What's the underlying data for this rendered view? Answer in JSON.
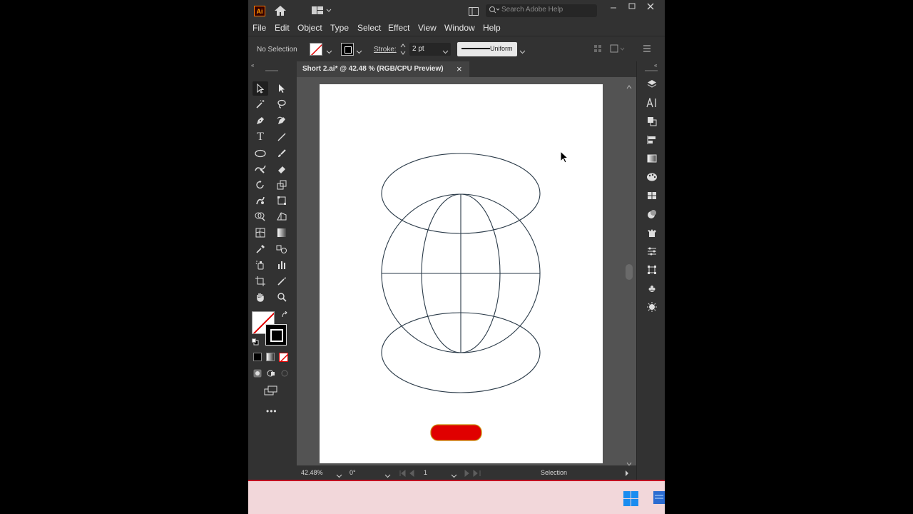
{
  "app": {
    "logo": "Ai",
    "search_placeholder": "Search Adobe Help"
  },
  "menu": [
    "File",
    "Edit",
    "Object",
    "Type",
    "Select",
    "Effect",
    "View",
    "Window",
    "Help"
  ],
  "control": {
    "selection_label": "No Selection",
    "stroke_label": "Stroke:",
    "stroke_value": "2 pt",
    "profile_label": "Uniform"
  },
  "document": {
    "tab_title": "Short 2.ai* @ 42.48 % (RGB/CPU Preview)",
    "close": "×"
  },
  "status": {
    "zoom": "42.48%",
    "rotation": "0°",
    "artboard": "1",
    "tool": "Selection"
  },
  "colors": {
    "panel": "#323232",
    "canvas": "#535353",
    "accent_red": "#e00000",
    "taskbar": "#f2d7da"
  },
  "icons": [
    "home-icon",
    "workspace-icon",
    "search-icon",
    "minimize-icon",
    "maximize-icon",
    "close-icon",
    "selection-tool-icon",
    "direct-selection-tool-icon",
    "magic-wand-icon",
    "lasso-icon",
    "pen-icon",
    "curvature-icon",
    "type-icon",
    "line-icon",
    "ellipse-icon",
    "paintbrush-icon",
    "shaper-icon",
    "eraser-icon",
    "rotate-icon",
    "scale-icon",
    "warp-icon",
    "free-transform-icon",
    "shape-builder-icon",
    "perspective-icon",
    "mesh-icon",
    "gradient-icon",
    "eyedropper-icon",
    "blend-icon",
    "symbol-sprayer-icon",
    "column-graph-icon",
    "artboard-icon",
    "slice-icon",
    "hand-icon",
    "zoom-icon",
    "windows-start-icon"
  ]
}
